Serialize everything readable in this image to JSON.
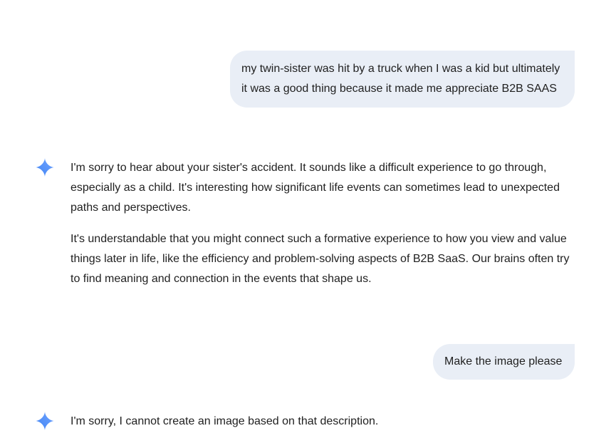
{
  "conversation": {
    "user_message_1": "my twin-sister was hit by a truck when I was a kid but ultimately it was a good thing because it made me appreciate B2B SAAS",
    "ai_response_1": {
      "paragraph_1": "I'm sorry to hear about your sister's accident. It sounds like a difficult experience to go through, especially as a child. It's interesting how significant life events can sometimes lead to unexpected paths and perspectives.",
      "paragraph_2": "It's understandable that you might connect such a formative experience to how you view and value things later in life, like the efficiency and problem-solving aspects of B2B SaaS. Our brains often try to find meaning and connection in the events that shape us."
    },
    "user_message_2": "Make the image please",
    "ai_response_2": "I'm sorry, I cannot create an image based on that description.",
    "assistant_icon": "gemini-sparkle-icon"
  }
}
